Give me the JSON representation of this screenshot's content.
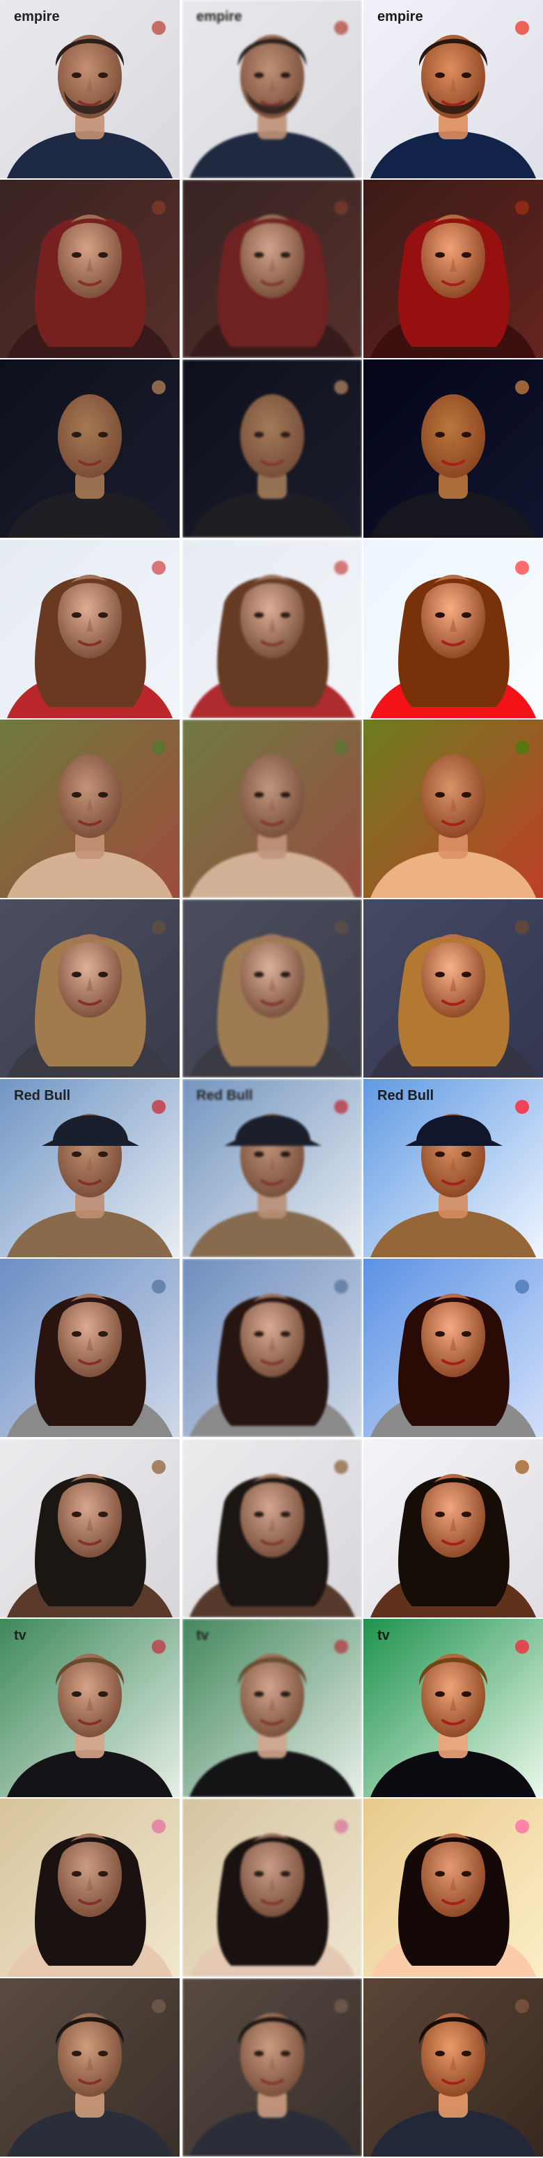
{
  "grid": {
    "rows": 12,
    "columns": 3,
    "column_roles": [
      "original",
      "degraded",
      "restored"
    ]
  },
  "rows": [
    {
      "subject": "man-with-beard-event-backdrop",
      "bg": "#e9e9ee",
      "bg2": "#d8d8de",
      "skin": "#c89070",
      "hair": "#2a1f1a",
      "shirt": "#1d2a44",
      "accent": "#c0392b",
      "text": "empire"
    },
    {
      "subject": "woman-red-hair",
      "bg": "#3a2322",
      "bg2": "#5a2f2a",
      "skin": "#d9a285",
      "hair": "#7a1f1e",
      "shirt": "#3a1a1a",
      "accent": "#8a3a2a",
      "text": ""
    },
    {
      "subject": "bald-man-dark",
      "bg": "#0d0f1c",
      "bg2": "#1a1d2e",
      "skin": "#a87a52",
      "hair": "#2a1f18",
      "shirt": "#1e1e24",
      "accent": "#c08a5a",
      "text": ""
    },
    {
      "subject": "woman-brown-bob",
      "bg": "#e6ecf4",
      "bg2": "#f1f4f9",
      "skin": "#e2ad90",
      "hair": "#6b3a1f",
      "shirt": "#c0262a",
      "accent": "#d94040",
      "text": ""
    },
    {
      "subject": "bald-man-outdoor",
      "bg": "#6f7a3a",
      "bg2": "#a24a3a",
      "skin": "#c69477",
      "hair": "#8a6a50",
      "shirt": "#d8b090",
      "accent": "#4f7a2a",
      "text": ""
    },
    {
      "subject": "woman-wavy-blonde",
      "bg": "#4a4e60",
      "bg2": "#3a3c4d",
      "skin": "#e2b096",
      "hair": "#a37a4a",
      "shirt": "#3a3a45",
      "accent": "#6a5040",
      "text": ""
    },
    {
      "subject": "man-cap-sky",
      "bg": "#6f96c8",
      "bg2": "#e8edf3",
      "skin": "#c08e6e",
      "hair": "#cfa070",
      "shirt": "#8a6a4a",
      "accent": "#d1202a",
      "text": "Red Bull"
    },
    {
      "subject": "woman-dark-hair-scarf",
      "bg": "#6a8fc8",
      "bg2": "#cfd9ea",
      "skin": "#deaa8e",
      "hair": "#2a1410",
      "shirt": "#8a8a8a",
      "accent": "#4f6f9a",
      "text": ""
    },
    {
      "subject": "woman-curly-hair",
      "bg": "#ecebee",
      "bg2": "#d8d6da",
      "skin": "#d9a68c",
      "hair": "#1c1612",
      "shirt": "#5a3a2a",
      "accent": "#8a5a2a",
      "text": ""
    },
    {
      "subject": "man-curly-green-backdrop",
      "bg": "#3a8a5a",
      "bg2": "#e6efe6",
      "skin": "#d8a486",
      "hair": "#6b4a2a",
      "shirt": "#141418",
      "accent": "#c92a3a",
      "text": "tv"
    },
    {
      "subject": "woman-smile-cupcakes",
      "bg": "#d9c49a",
      "bg2": "#f0e6cc",
      "skin": "#cf9c82",
      "hair": "#1a1210",
      "shirt": "#e8c8b0",
      "accent": "#e86aa0",
      "text": ""
    },
    {
      "subject": "man-dark-curly-hair",
      "bg": "#5a4a40",
      "bg2": "#3a302a",
      "skin": "#d29c7a",
      "hair": "#1e1612",
      "shirt": "#2a2e3a",
      "accent": "#7a6050",
      "text": ""
    }
  ]
}
